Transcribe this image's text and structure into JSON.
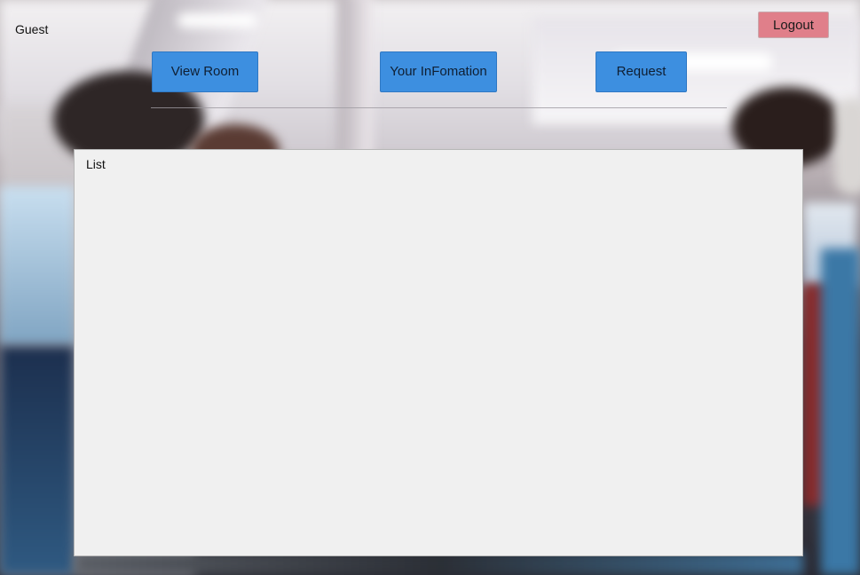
{
  "header": {
    "user_label": "Guest",
    "logout_label": "Logout"
  },
  "nav": {
    "view_room_label": "View Room",
    "your_information_label": "Your InFomation",
    "request_label": "Request"
  },
  "main": {
    "list_title": "List"
  },
  "colors": {
    "nav_button": "#3d8fe0",
    "logout_button": "#e07f8a",
    "panel_background": "#f0f0f0"
  }
}
